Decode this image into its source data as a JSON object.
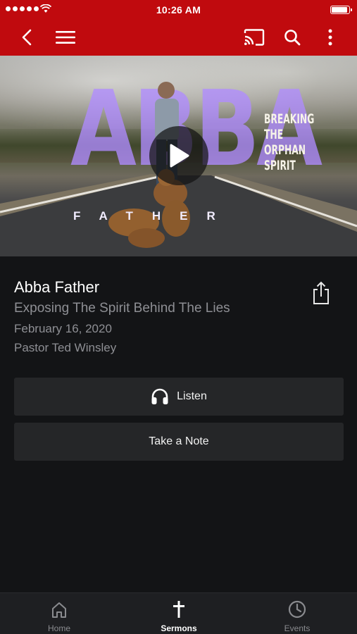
{
  "status_bar": {
    "time": "10:26 AM"
  },
  "nav": {
    "icons": [
      "back-icon",
      "menu-icon",
      "cast-icon",
      "search-icon",
      "more-icon"
    ],
    "color": "#c00a0e"
  },
  "artwork": {
    "title": "ABBA",
    "subtitle": "FATHER",
    "tagline": [
      "BREAKING",
      "THE",
      "ORPHAN",
      "SPIRIT"
    ]
  },
  "sermon": {
    "title": "Abba Father",
    "subtitle": "Exposing The Spirit Behind The Lies",
    "date": "February 16, 2020",
    "speaker": "Pastor Ted Winsley"
  },
  "actions": {
    "listen": "Listen",
    "note": "Take a Note"
  },
  "tabs": [
    {
      "label": "Home",
      "icon": "home-icon"
    },
    {
      "label": "Sermons",
      "icon": "cross-icon",
      "active": true
    },
    {
      "label": "Events",
      "icon": "clock-icon"
    }
  ]
}
